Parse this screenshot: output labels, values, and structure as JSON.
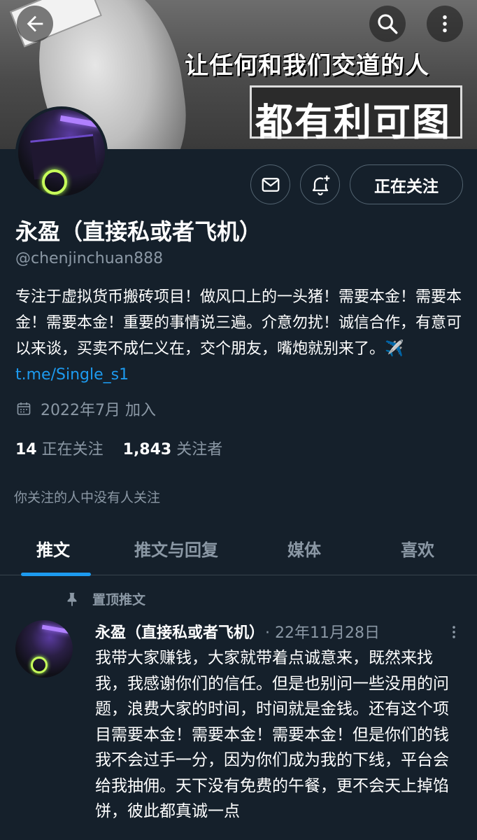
{
  "banner": {
    "line1": "让任何和我们交道的人",
    "line2": "都有利可图"
  },
  "profile": {
    "display_name": "永盈（直接私或者飞机）",
    "handle": "@chenjinchuan888",
    "bio_text": "专注于虚拟货币搬砖项目！做风口上的一头猪！需要本金！需要本金！需要本金！重要的事情说三遍。介意勿扰！诚信合作，有意可以来谈，买卖不成仁义在，交个朋友，嘴炮就别来了。✈️ ",
    "bio_link": "t.me/Single_s1",
    "joined": "2022年7月 加入",
    "following_count": "14",
    "following_label": "正在关注",
    "followers_count": "1,843",
    "followers_label": "关注者",
    "followed_by": "你关注的人中没有人关注",
    "follow_button": "正在关注"
  },
  "tabs": [
    {
      "label": "推文",
      "active": true
    },
    {
      "label": "推文与回复",
      "active": false
    },
    {
      "label": "媒体",
      "active": false
    },
    {
      "label": "喜欢",
      "active": false
    }
  ],
  "pinned_tweet": {
    "pinned_label": "置顶推文",
    "author": "永盈（直接私或者飞机）",
    "date": "· 22年11月28日",
    "text": "我带大家赚钱，大家就带着点诚意来，既然来找我，我感谢你们的信任。但是也别问一些没用的问题，浪费大家的时间，时间就是金钱。还有这个项目需要本金！需要本金！需要本金！但是你们的钱我不会过手一分，因为你们成为我的下线，平台会给我抽佣。天下没有免费的午餐，更不会天上掉馅饼，彼此都真诚一点"
  },
  "icons": {
    "back": "arrow-left-icon",
    "search": "search-icon",
    "more": "more-vertical-icon",
    "mail": "mail-icon",
    "notify": "bell-plus-icon",
    "calendar": "calendar-icon",
    "pin": "pin-icon"
  },
  "colors": {
    "background": "#15202b",
    "accent": "#1d9bf0",
    "secondary_text": "#8b98a5",
    "border": "#536471"
  }
}
